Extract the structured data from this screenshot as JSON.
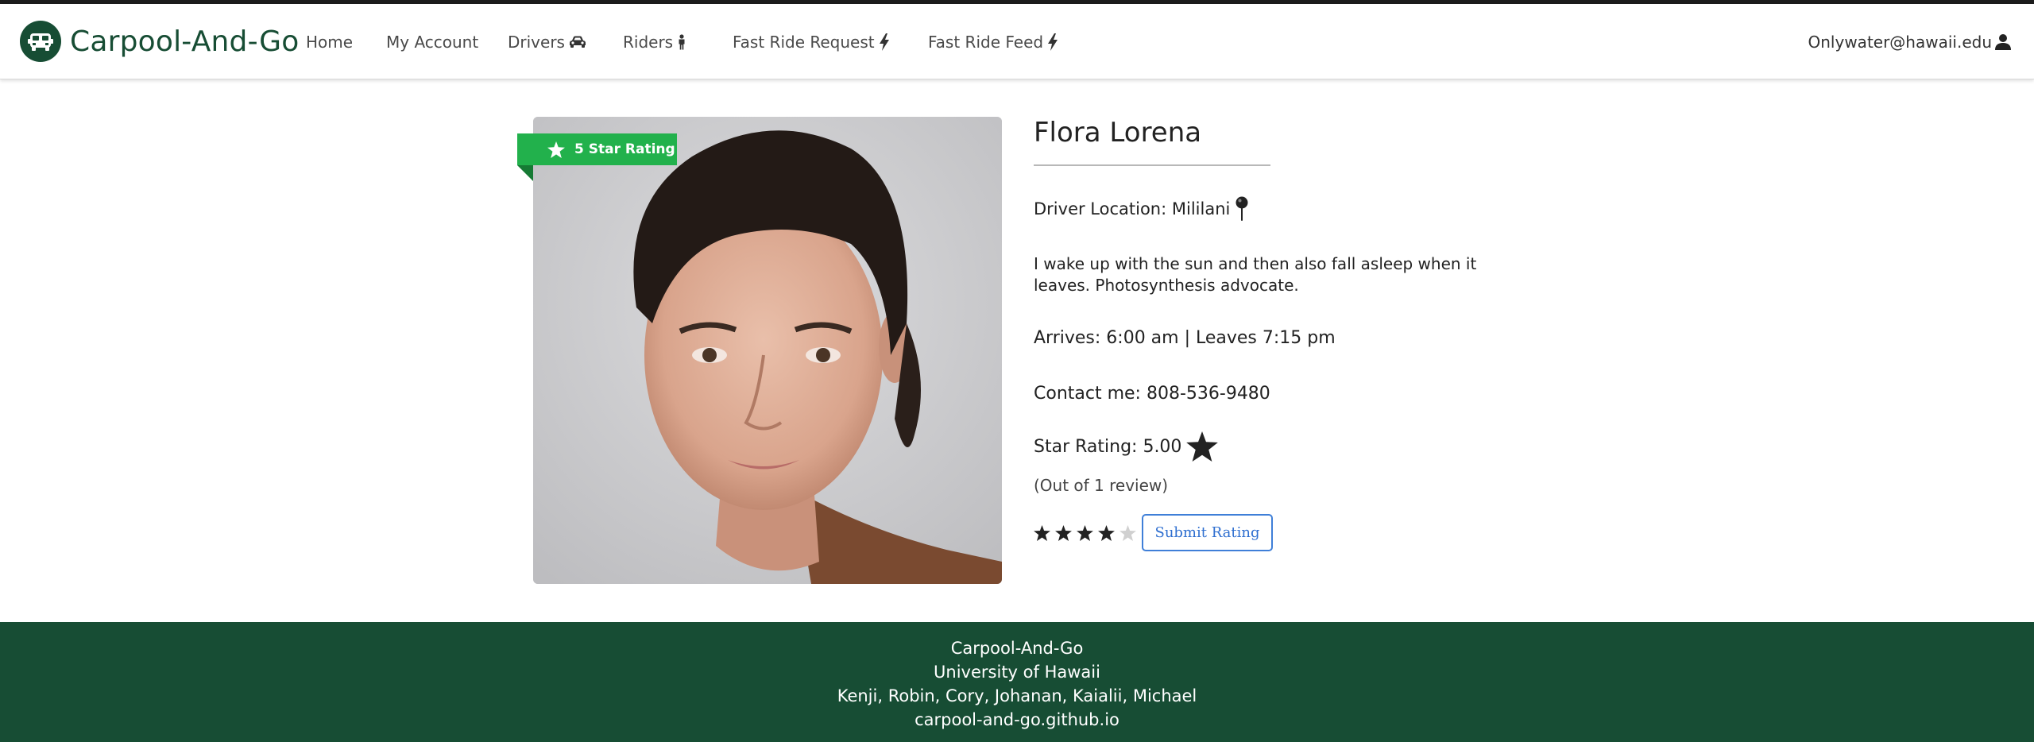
{
  "nav": {
    "brand": "Carpool-And-Go",
    "items": [
      {
        "label": "Home"
      },
      {
        "label": "My Account"
      },
      {
        "label": "Drivers"
      },
      {
        "label": "Riders"
      },
      {
        "label": "Fast Ride Request"
      },
      {
        "label": "Fast Ride Feed"
      }
    ],
    "user": "Onlywater@hawaii.edu"
  },
  "profile": {
    "badge": "5 Star Rating",
    "name": "Flora Lorena",
    "location": "Driver Location: Mililani",
    "bio": "I wake up with the sun and then also fall asleep when it leaves. Photosynthesis advocate.",
    "times": "Arrives: 6:00 am | Leaves 7:15 pm",
    "contact": "Contact me: 808-536-9480",
    "rating": "Star Rating: 5.00",
    "review_count": "(Out of 1 review)",
    "selected_stars": 4,
    "max_stars": 5,
    "submit_label": "Submit Rating"
  },
  "footer": {
    "line1": "Carpool-And-Go",
    "line2": "University of Hawaii",
    "line3": "Kenji, Robin, Cory, Johanan, Kaialii, Michael",
    "line4": "carpool-and-go.github.io"
  },
  "colors": {
    "brand_green": "#174d34",
    "badge_green": "#22b14c",
    "button_blue": "#3f7fd8"
  }
}
